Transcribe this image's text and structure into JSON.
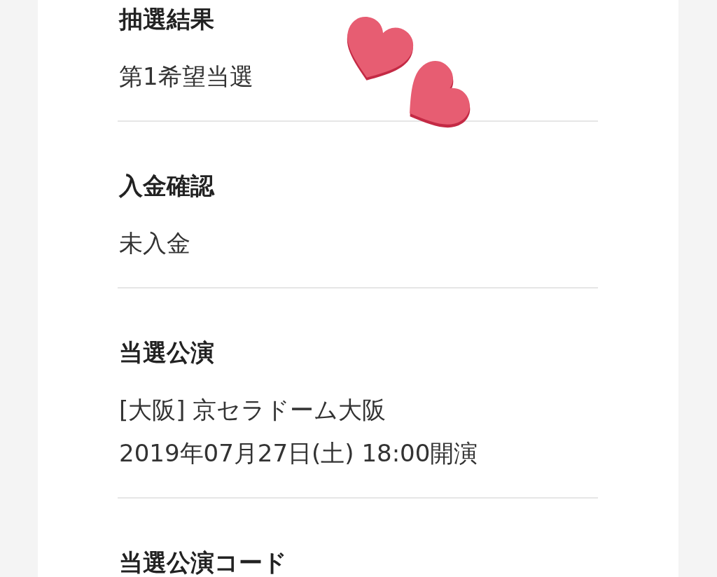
{
  "sections": [
    {
      "label": "抽選結果",
      "lines": [
        "第1希望当選"
      ]
    },
    {
      "label": "入金確認",
      "lines": [
        "未入金"
      ]
    },
    {
      "label": "当選公演",
      "lines": [
        "[大阪] 京セラドーム大阪",
        "2019年07月27日(土) 18:00開演"
      ]
    },
    {
      "label": "当選公演コード"
    }
  ]
}
